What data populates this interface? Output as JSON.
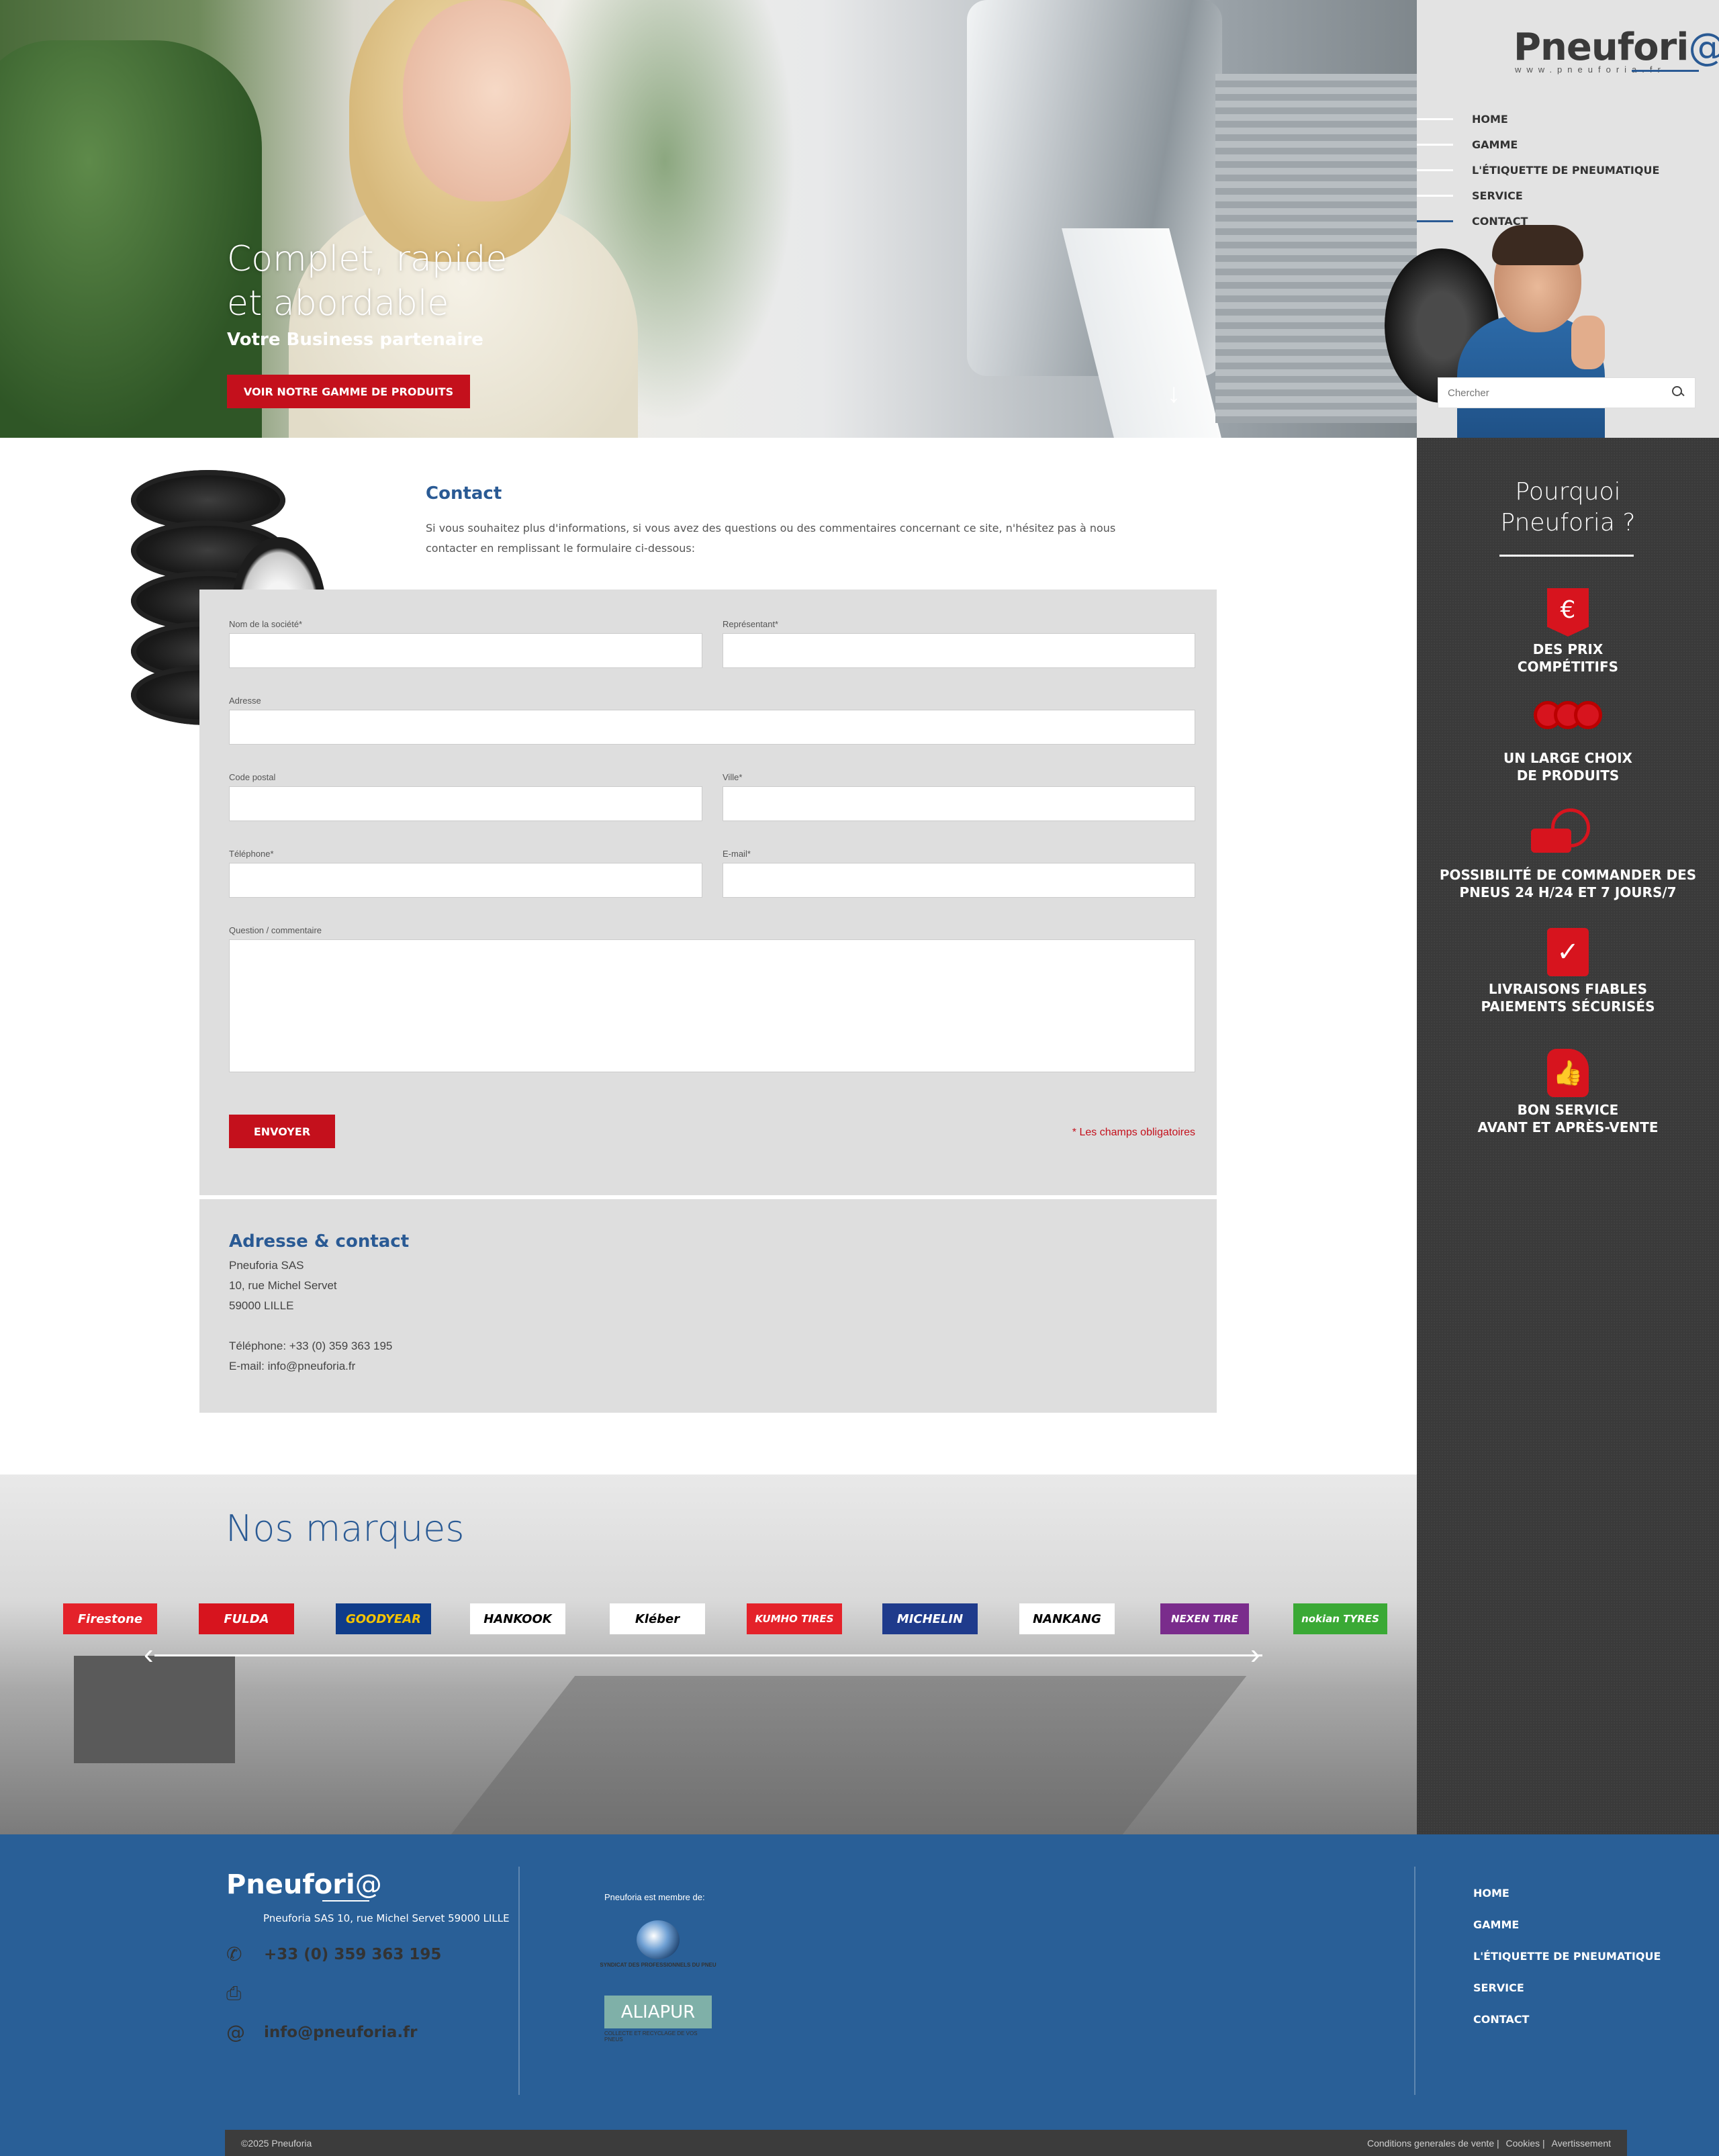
{
  "hero": {
    "title": "Complet, rapide\net abordable",
    "subtitle": "Votre Business partenaire",
    "cta_label": "VOIR NOTRE GAMME DE PRODUITS",
    "scroll_arrow": "↓"
  },
  "brand": {
    "logo_main": "Pneufori",
    "logo_at": "@",
    "logo_url": "www.pneuforia.fr"
  },
  "nav": {
    "items": [
      {
        "label": "HOME",
        "active": false
      },
      {
        "label": "GAMME",
        "active": false
      },
      {
        "label": "L'ÉTIQUETTE DE PNEUMATIQUE",
        "active": false
      },
      {
        "label": "SERVICE",
        "active": false
      },
      {
        "label": "CONTACT",
        "active": true
      }
    ]
  },
  "search": {
    "placeholder": "Chercher",
    "icon": "search-icon"
  },
  "why": {
    "title": "Pourquoi\nPneuforia ?",
    "features": [
      {
        "icon": "euro-shield-icon",
        "label": "DES PRIX\nCOMPÉTITIFS"
      },
      {
        "icon": "tires-icon",
        "label": "UN LARGE CHOIX\nDE PRODUITS"
      },
      {
        "icon": "clock-truck-icon",
        "label": "POSSIBILITÉ DE COMMANDER DES\nPNEUS 24 H/24 ET 7 JOURS/7"
      },
      {
        "icon": "clipboard-check-icon",
        "label": "LIVRAISONS FIABLES\nPAIEMENTS SÉCURISÉS"
      },
      {
        "icon": "thumbs-up-icon",
        "label": "BON SERVICE\nAVANT ET APRÈS-VENTE"
      }
    ]
  },
  "contact": {
    "title": "Contact",
    "intro": "Si vous souhaitez plus d'informations, si vous avez des questions ou des commentaires concernant ce site, n'hésitez pas à nous contacter en remplissant le formulaire ci-dessous:",
    "fields": {
      "company": "Nom de la société*",
      "representative": "Représentant*",
      "address": "Adresse",
      "postal": "Code postal",
      "city": "Ville*",
      "phone": "Téléphone*",
      "email": "E-mail*",
      "comment": "Question / commentaire"
    },
    "send_label": "ENVOYER",
    "required_note": "* Les champs obligatoires"
  },
  "address_block": {
    "title": "Adresse & contact",
    "lines": "Pneuforia SAS\n10, rue Michel Servet\n59000 LILLE\n\nTéléphone: +33 (0) 359 363 195\nE-mail: info@pneuforia.fr"
  },
  "brands": {
    "title": "Nos marques",
    "logos": [
      {
        "name": "Firestone",
        "bg": "#e4222a",
        "fg": "#ffffff"
      },
      {
        "name": "FULDA",
        "bg": "#d7141e",
        "fg": "#ffffff"
      },
      {
        "name": "GOODYEAR",
        "bg": "#0f3c8a",
        "fg": "#f5c400"
      },
      {
        "name": "HANKOOK",
        "bg": "#ffffff",
        "fg": "#000000"
      },
      {
        "name": "Kléber",
        "bg": "#ffffff",
        "fg": "#000000"
      },
      {
        "name": "KUMHO TIRES",
        "bg": "#e4222a",
        "fg": "#ffffff"
      },
      {
        "name": "MICHELIN",
        "bg": "#1f3b8c",
        "fg": "#ffffff"
      },
      {
        "name": "NANKANG",
        "bg": "#ffffff",
        "fg": "#000000"
      },
      {
        "name": "NEXEN TIRE",
        "bg": "#7a2c8c",
        "fg": "#ffffff"
      },
      {
        "name": "nokian TYRES",
        "bg": "#3aa935",
        "fg": "#ffffff"
      }
    ],
    "prev": "‹",
    "next": "›"
  },
  "footer": {
    "logo_main": "Pneufori",
    "logo_at": "@",
    "address": "Pneuforia SAS 10, rue Michel Servet 59000 LILLE",
    "phone": "+33 (0) 359 363 195",
    "fax": "",
    "email": "info@pneuforia.fr",
    "member_label": "Pneuforia est membre de:",
    "badge1_caption": "SYNDICAT DES PROFESSIONNELS DU PNEU",
    "badge2_name": "ALIAPUR",
    "badge2_caption": "COLLECTE ET RECYCLAGE DE VOS PNEUS",
    "nav": [
      "HOME",
      "GAMME",
      "L'ÉTIQUETTE DE PNEUMATIQUE",
      "SERVICE",
      "CONTACT"
    ],
    "copyright": "©2025 Pneuforia",
    "links": [
      "Conditions generales de vente",
      "Cookies",
      "Avertissement"
    ]
  }
}
